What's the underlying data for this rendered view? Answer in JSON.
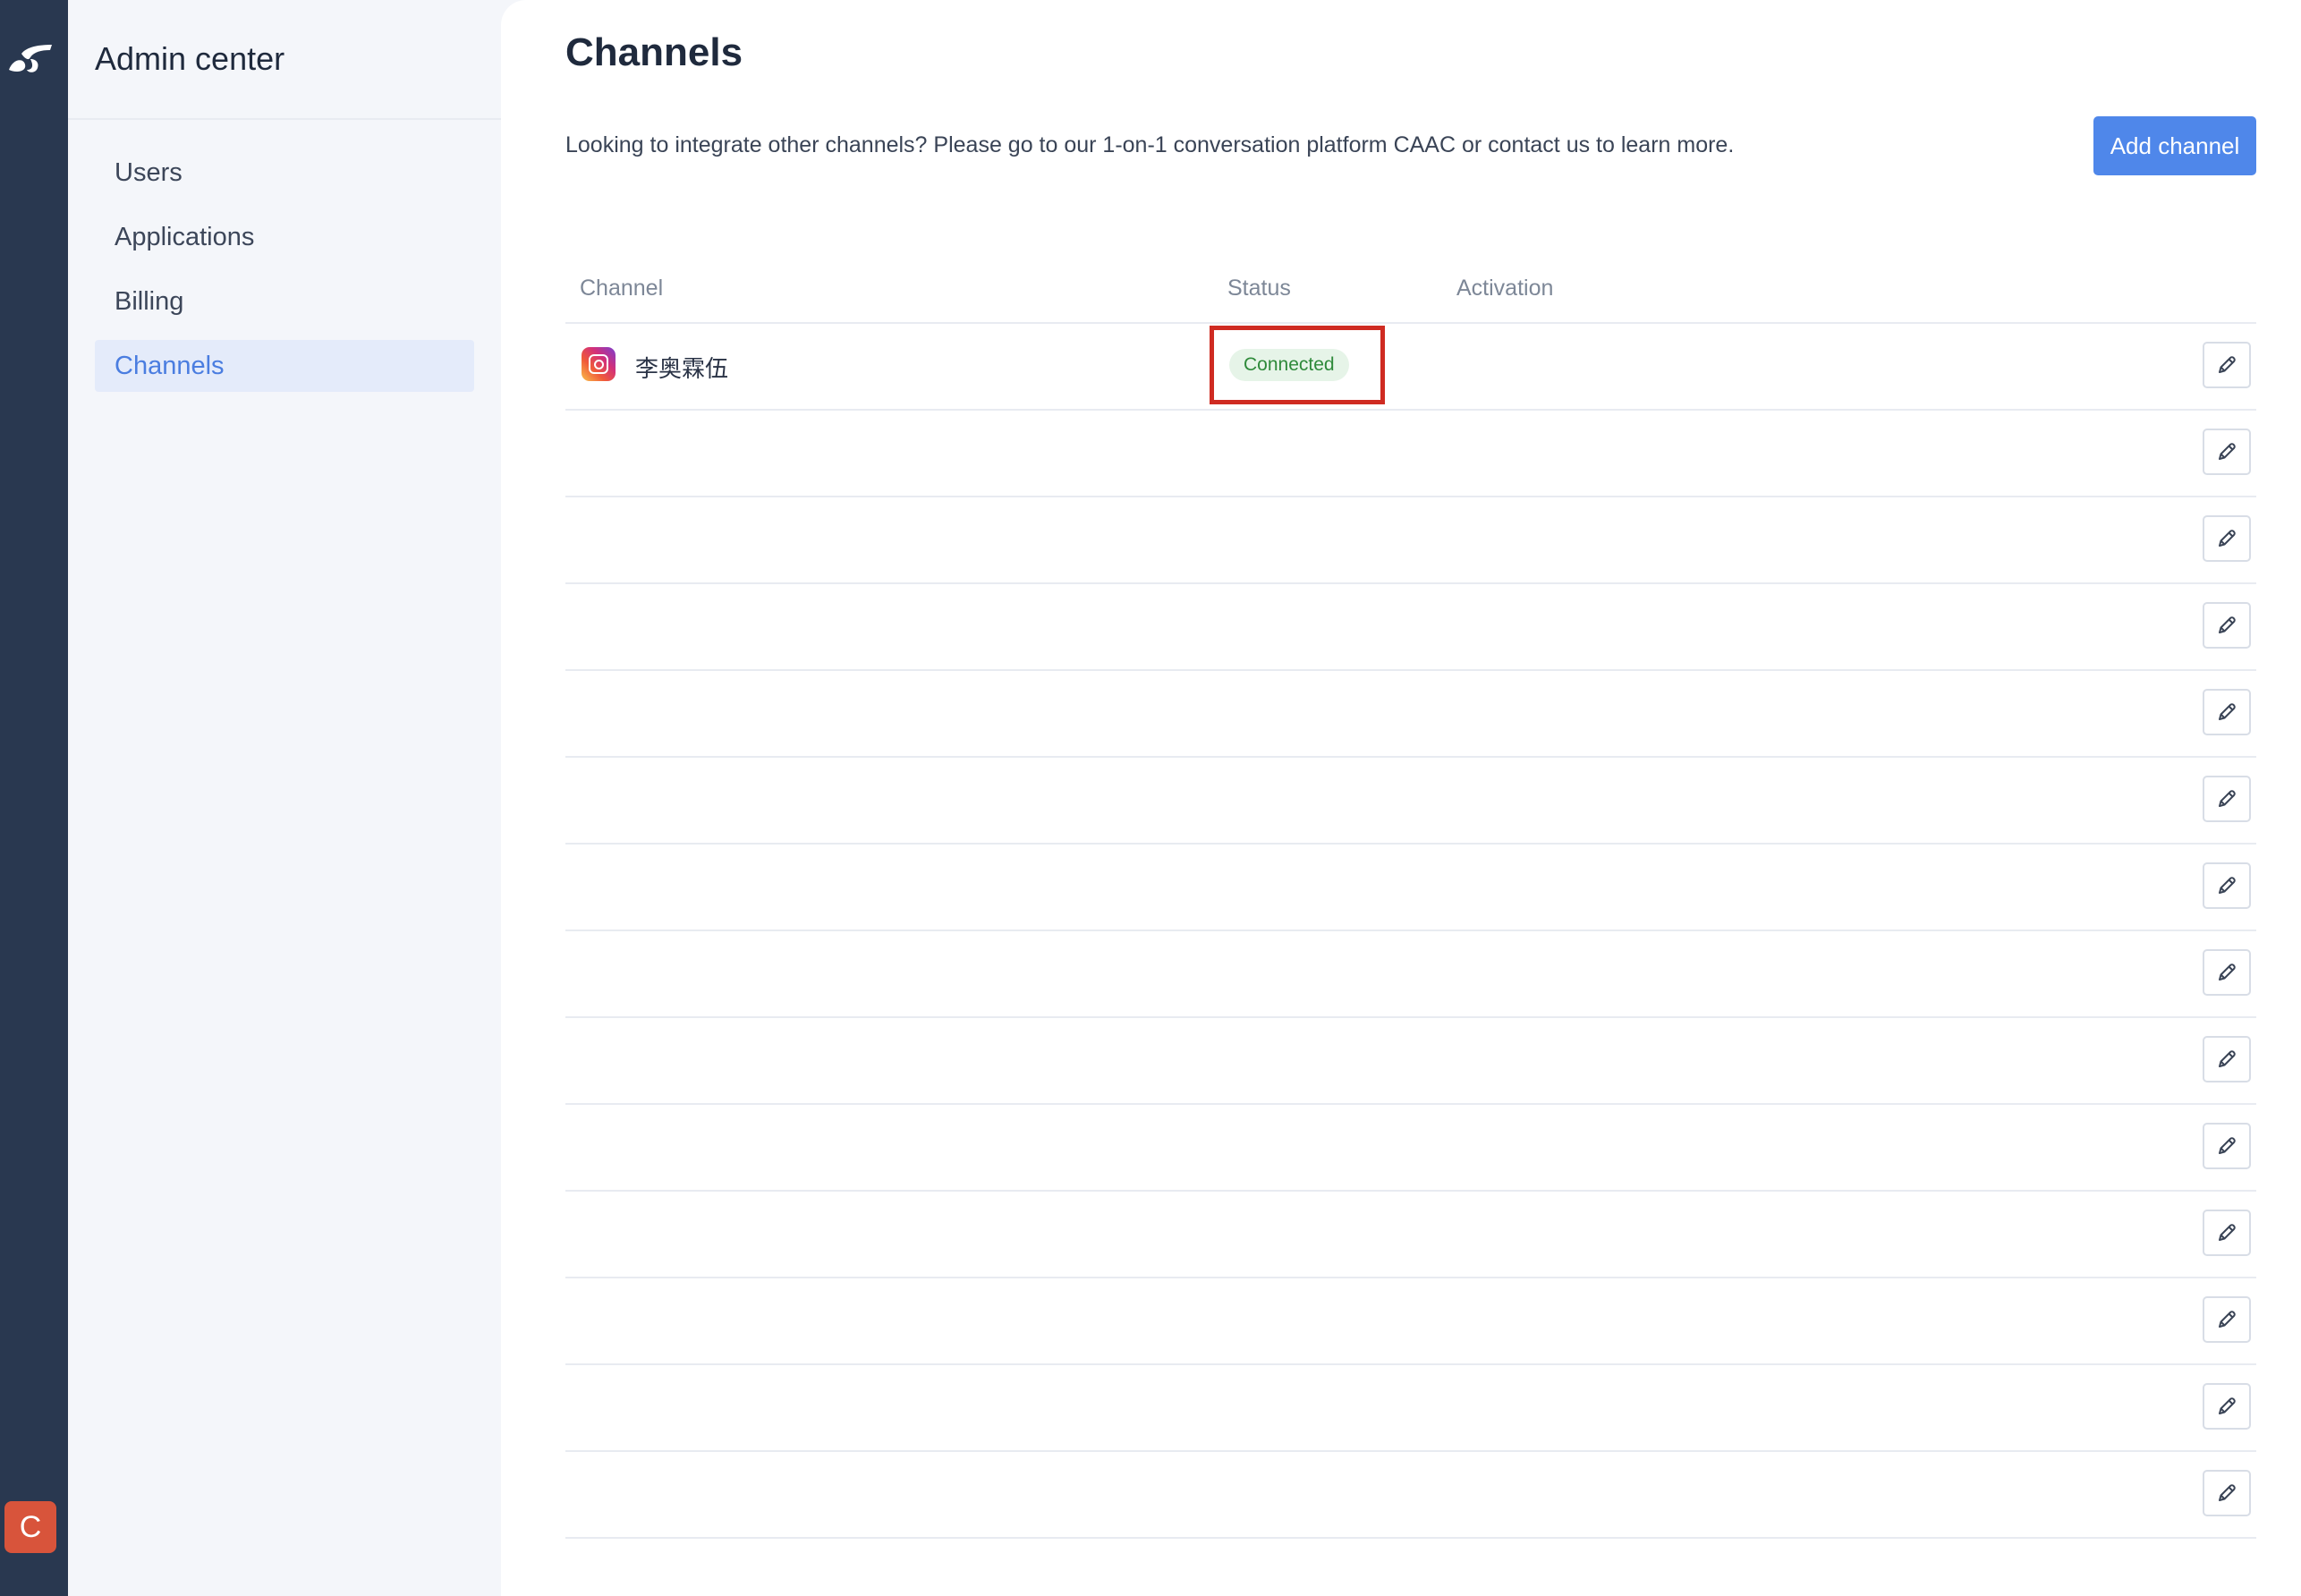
{
  "app": {
    "logo_icon": "brand-logo-icon",
    "avatar_letter": "C",
    "avatar_color": "#d8543b",
    "rail_color": "#293850",
    "accent_color": "#4f87ea"
  },
  "sidebar": {
    "title": "Admin center",
    "items": [
      {
        "label": "Users",
        "active": false
      },
      {
        "label": "Applications",
        "active": false
      },
      {
        "label": "Billing",
        "active": false
      },
      {
        "label": "Channels",
        "active": true
      }
    ]
  },
  "main": {
    "title": "Channels",
    "intro": "Looking to integrate other channels? Please go to our 1-on-1 conversation platform CAAC or contact us to learn more.",
    "add_button": "Add channel"
  },
  "table": {
    "columns": [
      "Channel",
      "Status",
      "Activation"
    ],
    "rows": [
      {
        "channel": "李奥霖伍",
        "channel_icon": "instagram-icon",
        "status": "Connected",
        "activation": ""
      },
      {
        "channel": "",
        "status": "",
        "activation": ""
      },
      {
        "channel": "",
        "status": "",
        "activation": ""
      },
      {
        "channel": "",
        "status": "",
        "activation": ""
      },
      {
        "channel": "",
        "status": "",
        "activation": ""
      },
      {
        "channel": "",
        "status": "",
        "activation": ""
      },
      {
        "channel": "",
        "status": "",
        "activation": ""
      },
      {
        "channel": "",
        "status": "",
        "activation": ""
      },
      {
        "channel": "",
        "status": "",
        "activation": ""
      },
      {
        "channel": "",
        "status": "",
        "activation": ""
      },
      {
        "channel": "",
        "status": "",
        "activation": ""
      },
      {
        "channel": "",
        "status": "",
        "activation": ""
      },
      {
        "channel": "",
        "status": "",
        "activation": ""
      },
      {
        "channel": "",
        "status": "",
        "activation": ""
      }
    ],
    "row_action_icon": "pencil-edit-icon",
    "status_colors": {
      "connected_bg": "#e6f4e8",
      "connected_text": "#2e8a3a"
    }
  }
}
